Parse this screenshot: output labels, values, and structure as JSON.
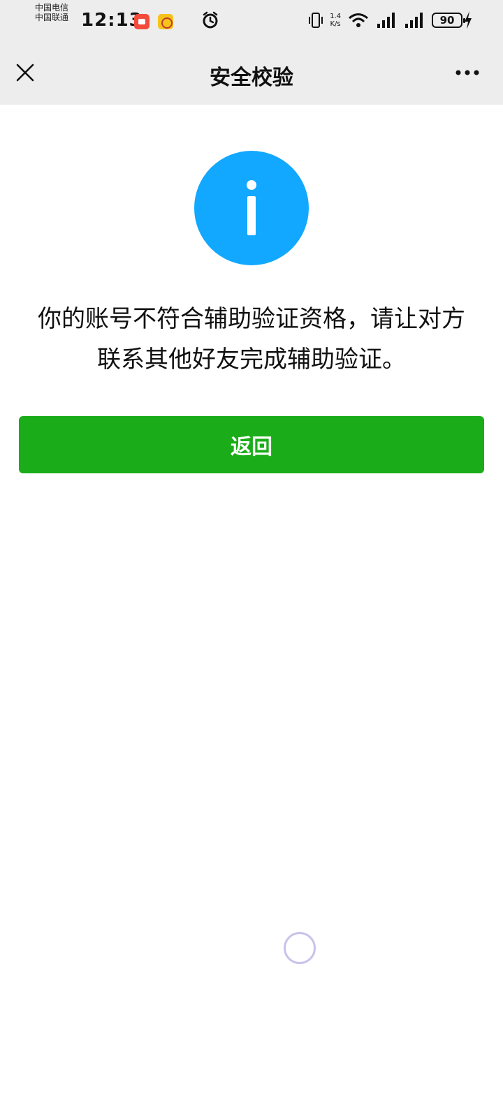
{
  "status_bar": {
    "carrier_1": "中国电信",
    "carrier_2": "中国联通",
    "time": "12:13",
    "speed_value": "1.4",
    "speed_unit": "K/s",
    "battery": "90",
    "icons": [
      "video-app-icon",
      "yellow-app-icon",
      "alarm-icon",
      "vibrate-icon",
      "wifi-icon",
      "signal-4g-icon",
      "signal-4g-icon",
      "battery-icon",
      "charging-bolt-icon"
    ]
  },
  "nav": {
    "title": "安全校验",
    "close_icon": "close-icon",
    "more_icon": "more-dots-icon"
  },
  "main": {
    "icon": "info-icon",
    "accent_color": "#12a8ff",
    "message_line_1": "你的账号不符合辅助验证资格，请让对方",
    "message_line_2": "联系其他好友完成辅助验证。",
    "back_button_label": "返回",
    "button_color": "#1aad19"
  }
}
